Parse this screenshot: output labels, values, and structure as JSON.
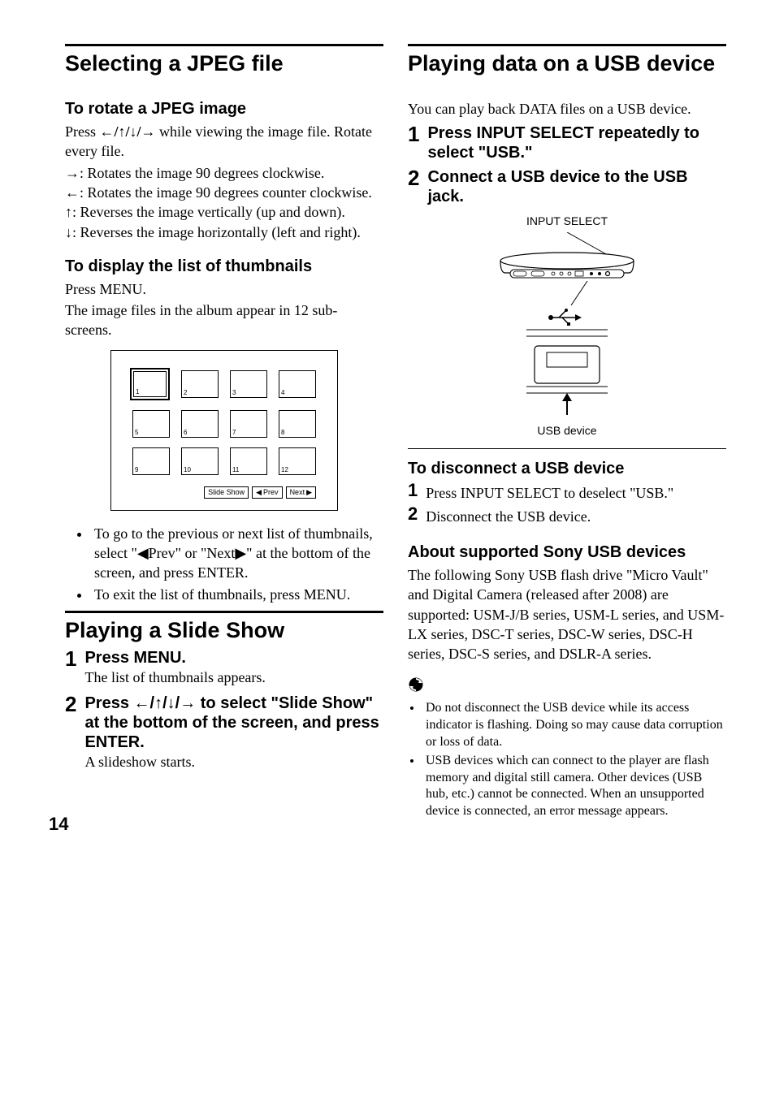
{
  "page_number": "14",
  "left": {
    "heading1": "Selecting a JPEG file",
    "rotate_heading": "To rotate a JPEG image",
    "rotate_intro_pre": "Press ",
    "rotate_intro_arrows": "←/↑/↓/→",
    "rotate_intro_post": " while viewing the image file. Rotate every file.",
    "arrow_right_sym": "→",
    "arrow_right_text": ": Rotates the image 90 degrees clockwise.",
    "arrow_left_sym": "←",
    "arrow_left_text": ": Rotates the image 90 degrees counter clockwise.",
    "arrow_up_sym": "↑",
    "arrow_up_text": ": Reverses the image vertically (up and down).",
    "arrow_down_sym": "↓",
    "arrow_down_text": ": Reverses the image horizontally (left and right).",
    "thumbs_heading": "To display the list of thumbnails",
    "thumbs_p1": "Press MENU.",
    "thumbs_p2": "The image files in the album appear in 12 sub-screens.",
    "thumb_labels": [
      "1",
      "2",
      "3",
      "4",
      "5",
      "6",
      "7",
      "8",
      "9",
      "10",
      "11",
      "12"
    ],
    "thumbs_btn_slide": "Slide Show",
    "thumbs_btn_prev": "Prev",
    "thumbs_btn_next": "Next",
    "thumbs_bullet1": "To go to the previous or next list of thumbnails, select \"◀Prev\" or \"Next▶\" at the bottom of the screen, and press ENTER.",
    "thumbs_bullet2": "To exit the list of thumbnails, press MENU.",
    "heading2": "Playing a Slide Show",
    "slide_step1_num": "1",
    "slide_step1_head": "Press MENU.",
    "slide_step1_body": "The list of thumbnails appears.",
    "slide_step2_num": "2",
    "slide_step2_head_pre": "Press ",
    "slide_step2_head_arrows": "←/↑/↓/→",
    "slide_step2_head_post": " to select \"Slide Show\" at the bottom of the screen, and press ENTER.",
    "slide_step2_body": "A slideshow starts."
  },
  "right": {
    "heading1": "Playing data on a USB device",
    "intro": "You can play back DATA files on a USB device.",
    "step1_num": "1",
    "step1_head": "Press INPUT SELECT repeatedly to select \"USB.\"",
    "step2_num": "2",
    "step2_head": "Connect a USB device to the USB jack.",
    "fig_label_top": "INPUT SELECT",
    "fig_label_bottom": "USB device",
    "disconnect_heading": "To disconnect a USB device",
    "disc_step1_num": "1",
    "disc_step1_body": "Press INPUT SELECT to deselect \"USB.\"",
    "disc_step2_num": "2",
    "disc_step2_body": "Disconnect the USB device.",
    "supported_heading": "About supported Sony USB devices",
    "supported_body": "The following Sony USB flash drive \"Micro Vault\" and Digital Camera (released after 2008) are supported: USM-J/B series, USM-L series, and USM-LX series, DSC-T series, DSC-W series, DSC-H series, DSC-S series, and DSLR-A series.",
    "note_bullet1": "Do not disconnect the USB device while its access indicator is flashing. Doing so may cause data corruption or loss of data.",
    "note_bullet2": "USB devices which can connect to the player are flash memory and digital still camera. Other devices (USB hub, etc.) cannot be connected. When an unsupported device is connected, an error message appears."
  }
}
